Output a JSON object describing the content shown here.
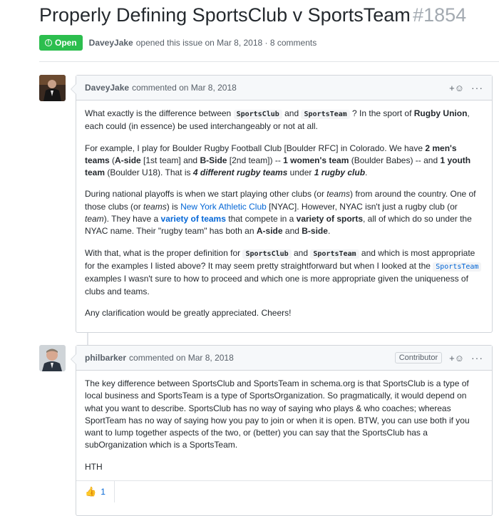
{
  "issue": {
    "title": "Properly Defining SportsClub v SportsTeam",
    "number": "#1854",
    "state": "Open",
    "author": "DaveyJake",
    "meta_text": "opened this issue on Mar 8, 2018 · 8 comments"
  },
  "comments": [
    {
      "author": "DaveyJake",
      "action": "commented on Mar 8, 2018",
      "reaction_icon": "+☺",
      "more_icon": "···",
      "paragraphs": [
        {
          "segments": [
            {
              "t": "What exactly is the difference between "
            },
            {
              "t": "SportsClub",
              "s": "code"
            },
            {
              "t": " and "
            },
            {
              "t": "SportsTeam",
              "s": "code"
            },
            {
              "t": " ? In the sport of "
            },
            {
              "t": "Rugby Union",
              "s": "b"
            },
            {
              "t": ", each could (in essence) be used interchangeably or not at all."
            }
          ]
        },
        {
          "segments": [
            {
              "t": "For example, I play for Boulder Rugby Football Club [Boulder RFC] in Colorado. We have "
            },
            {
              "t": "2 men's teams",
              "s": "b"
            },
            {
              "t": " ("
            },
            {
              "t": "A-side",
              "s": "b"
            },
            {
              "t": " [1st team] and "
            },
            {
              "t": "B-Side",
              "s": "b"
            },
            {
              "t": " [2nd team]) -- "
            },
            {
              "t": "1 women's team",
              "s": "b"
            },
            {
              "t": " (Boulder Babes) -- and "
            },
            {
              "t": "1 youth team",
              "s": "b"
            },
            {
              "t": " (Boulder U18). That is "
            },
            {
              "t": "4 different rugby teams",
              "s": "bi"
            },
            {
              "t": " under "
            },
            {
              "t": "1 rugby club",
              "s": "bi"
            },
            {
              "t": "."
            }
          ]
        },
        {
          "segments": [
            {
              "t": "During national playoffs is when we start playing other clubs (or "
            },
            {
              "t": "teams",
              "s": "i"
            },
            {
              "t": ") from around the country. One of those clubs (or "
            },
            {
              "t": "teams",
              "s": "i"
            },
            {
              "t": ") is "
            },
            {
              "t": "New York Athletic Club",
              "s": "link"
            },
            {
              "t": " [NYAC]. However, NYAC isn't just a rugby club (or "
            },
            {
              "t": "team",
              "s": "i"
            },
            {
              "t": "). They have a "
            },
            {
              "t": "variety of teams",
              "s": "blink"
            },
            {
              "t": " that compete in a "
            },
            {
              "t": "variety of sports",
              "s": "b"
            },
            {
              "t": ", all of which do so under the NYAC name. Their \"rugby team\" has both an "
            },
            {
              "t": "A-side",
              "s": "b"
            },
            {
              "t": " and "
            },
            {
              "t": "B-side",
              "s": "b"
            },
            {
              "t": "."
            }
          ]
        },
        {
          "segments": [
            {
              "t": "With that, what is the proper definition for "
            },
            {
              "t": "SportsClub",
              "s": "code"
            },
            {
              "t": " and "
            },
            {
              "t": "SportsTeam",
              "s": "code"
            },
            {
              "t": " and which is most appropriate for the examples I listed above? It may seem pretty straightforward but when I looked at the "
            },
            {
              "t": "SportsTeam",
              "s": "codelink"
            },
            {
              "t": " examples I wasn't sure to how to proceed and which one is more appropriate given the uniqueness of clubs and teams."
            }
          ]
        },
        {
          "segments": [
            {
              "t": "Any clarification would be greatly appreciated. Cheers!"
            }
          ]
        }
      ]
    },
    {
      "author": "philbarker",
      "action": "commented on Mar 8, 2018",
      "badge": "Contributor",
      "reaction_icon": "+☺",
      "more_icon": "···",
      "paragraphs": [
        {
          "segments": [
            {
              "t": "The key difference between SportsClub and SportsTeam in schema.org is that SportsClub is a type of local business and SportsTeam is a type of SportsOrganization. So pragmatically, it would depend on what you want to describe. SportsClub has no way of saying who plays & who coaches; whereas SportTeam has no way of saying how you pay to join or when it is open. BTW, you can use both if you want to lump together aspects of the two, or (better) you can say that the SportsClub has a subOrganization which is a SportsTeam."
            }
          ]
        },
        {
          "segments": [
            {
              "t": "HTH"
            }
          ]
        }
      ],
      "reactions": [
        {
          "emoji": "👍",
          "count": "1"
        }
      ]
    }
  ]
}
